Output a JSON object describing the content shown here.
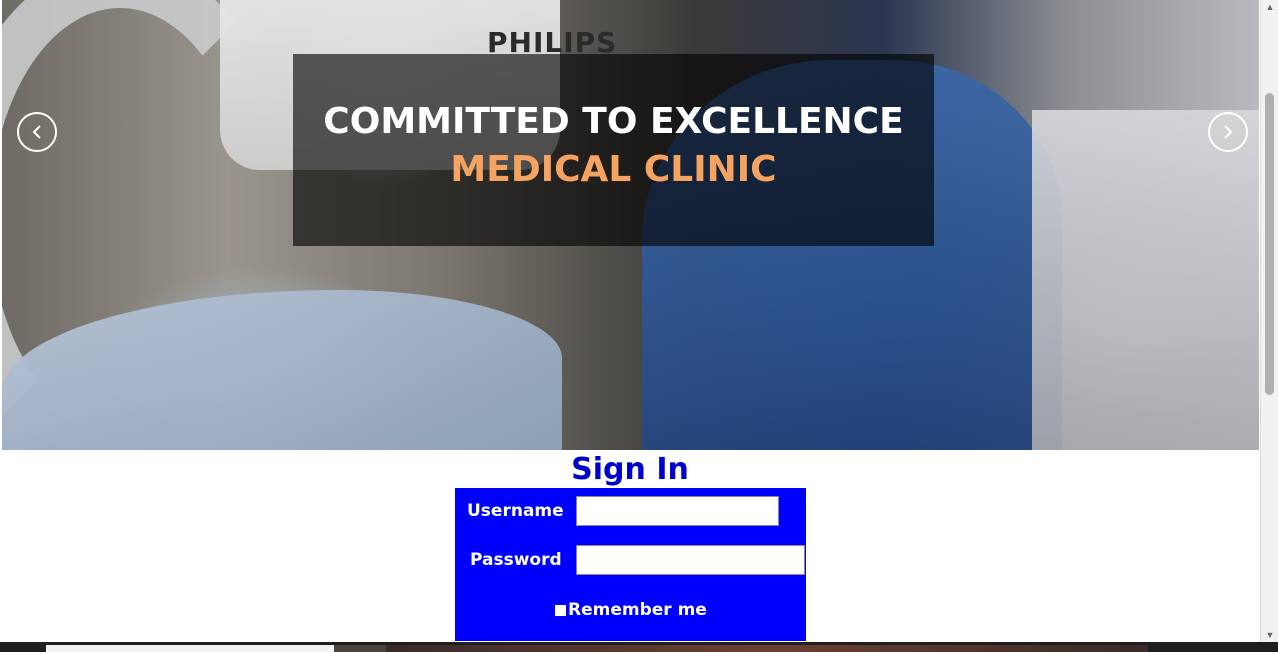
{
  "hero": {
    "title_line1": "COMMITTED TO EXCELLENCE",
    "title_line2": "MEDICAL CLINIC",
    "machine_brand": "PHILIPS"
  },
  "carousel": {
    "prev_icon": "chevron-left-icon",
    "next_icon": "chevron-right-icon"
  },
  "signin": {
    "title": "Sign In",
    "username_label": "Username",
    "password_label": "Password",
    "username_value": "",
    "password_value": "",
    "remember_label": "Remember me"
  },
  "colors": {
    "form_bg": "#0000ff",
    "title_color": "#0000cc",
    "accent": "#f4a460"
  }
}
